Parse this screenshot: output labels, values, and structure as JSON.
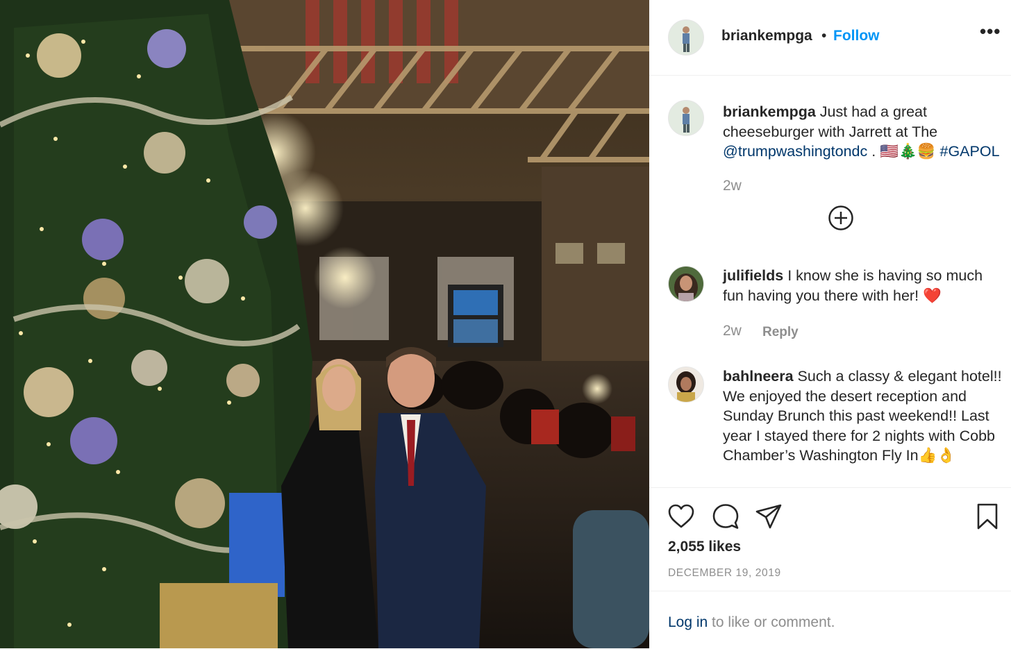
{
  "post": {
    "username": "briankempga",
    "separator": "•",
    "follow_label": "Follow",
    "more_label": "•••",
    "likes": "2,055 likes",
    "date": "DECEMBER 19, 2019"
  },
  "caption": {
    "username": "briankempga",
    "text_1": " Just had a great cheeseburger with Jarrett at The ",
    "mention": "@trumpwashingtondc",
    "text_2": " . 🇺🇸🎄🍔 ",
    "hashtag": "#GAPOL",
    "time": "2w"
  },
  "comments": [
    {
      "username": "julifields",
      "text": " I know she is having so much fun having you there with her! ❤️",
      "time": "2w",
      "reply": "Reply"
    },
    {
      "username": "bahlneera",
      "text": " Such a classy & elegant hotel!! We enjoyed the desert reception and Sunday Brunch this past weekend!! Last year I stayed there for 2 nights with Cobb Chamber’s Washington Fly In👍👌"
    }
  ],
  "login": {
    "link": "Log in",
    "rest": " to like or comment."
  },
  "icons": [
    "like-icon",
    "comment-icon",
    "share-icon",
    "save-icon",
    "add-circle-icon"
  ],
  "colors": {
    "accent": "#0095f6",
    "link": "#00376b",
    "muted": "#8e8e8e",
    "heart": "#ed4956"
  }
}
